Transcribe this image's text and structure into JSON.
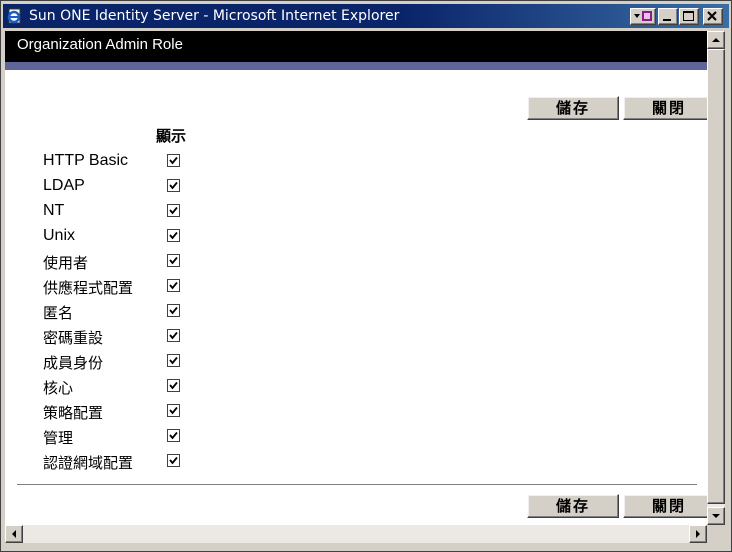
{
  "window": {
    "title": "Sun ONE Identity Server - Microsoft Internet Explorer",
    "controls": [
      "minimize",
      "maximize",
      "close"
    ]
  },
  "page": {
    "header_title": "Organization Admin Role",
    "save_label": "儲存",
    "close_label": "關閉",
    "column_header": "顯示"
  },
  "rows": [
    {
      "label": "HTTP Basic",
      "checked": true
    },
    {
      "label": "LDAP",
      "checked": true
    },
    {
      "label": "NT",
      "checked": true
    },
    {
      "label": "Unix",
      "checked": true
    },
    {
      "label": "使用者",
      "checked": true
    },
    {
      "label": "供應程式配置",
      "checked": true
    },
    {
      "label": "匿名",
      "checked": true
    },
    {
      "label": "密碼重設",
      "checked": true
    },
    {
      "label": "成員身份",
      "checked": true
    },
    {
      "label": "核心",
      "checked": true
    },
    {
      "label": "策略配置",
      "checked": true
    },
    {
      "label": "管理",
      "checked": true
    },
    {
      "label": "認證網域配置",
      "checked": true
    }
  ],
  "colors": {
    "titlebar": "#0a246a",
    "header_bar": "#000000",
    "accent_bar": "#5f6597"
  }
}
